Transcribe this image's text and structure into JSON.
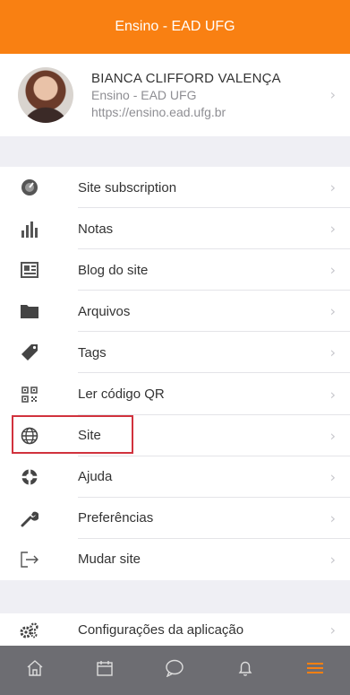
{
  "header": {
    "title": "Ensino - EAD UFG"
  },
  "profile": {
    "name": "BIANCA CLIFFORD VALENÇA",
    "site_name": "Ensino - EAD UFG",
    "site_url": "https://ensino.ead.ufg.br"
  },
  "menu": {
    "items": [
      {
        "label": "Site subscription",
        "icon": "dashboard-icon"
      },
      {
        "label": "Notas",
        "icon": "bar-chart-icon"
      },
      {
        "label": "Blog do site",
        "icon": "newspaper-icon"
      },
      {
        "label": "Arquivos",
        "icon": "folder-icon"
      },
      {
        "label": "Tags",
        "icon": "tag-icon"
      },
      {
        "label": "Ler código QR",
        "icon": "qr-code-icon"
      },
      {
        "label": "Site",
        "icon": "globe-icon"
      },
      {
        "label": "Ajuda",
        "icon": "lifebuoy-icon"
      },
      {
        "label": "Preferências",
        "icon": "wrench-icon"
      },
      {
        "label": "Mudar site",
        "icon": "logout-icon"
      }
    ]
  },
  "config": {
    "label": "Configurações da aplicação",
    "icon": "gears-icon"
  },
  "tabbar": {
    "tabs": [
      "home-icon",
      "calendar-icon",
      "chat-icon",
      "bell-icon",
      "menu-icon"
    ],
    "active": "menu-icon"
  },
  "colors": {
    "brand": "#f98012",
    "tabbar": "#6d6d72",
    "highlight": "#d1323d"
  }
}
